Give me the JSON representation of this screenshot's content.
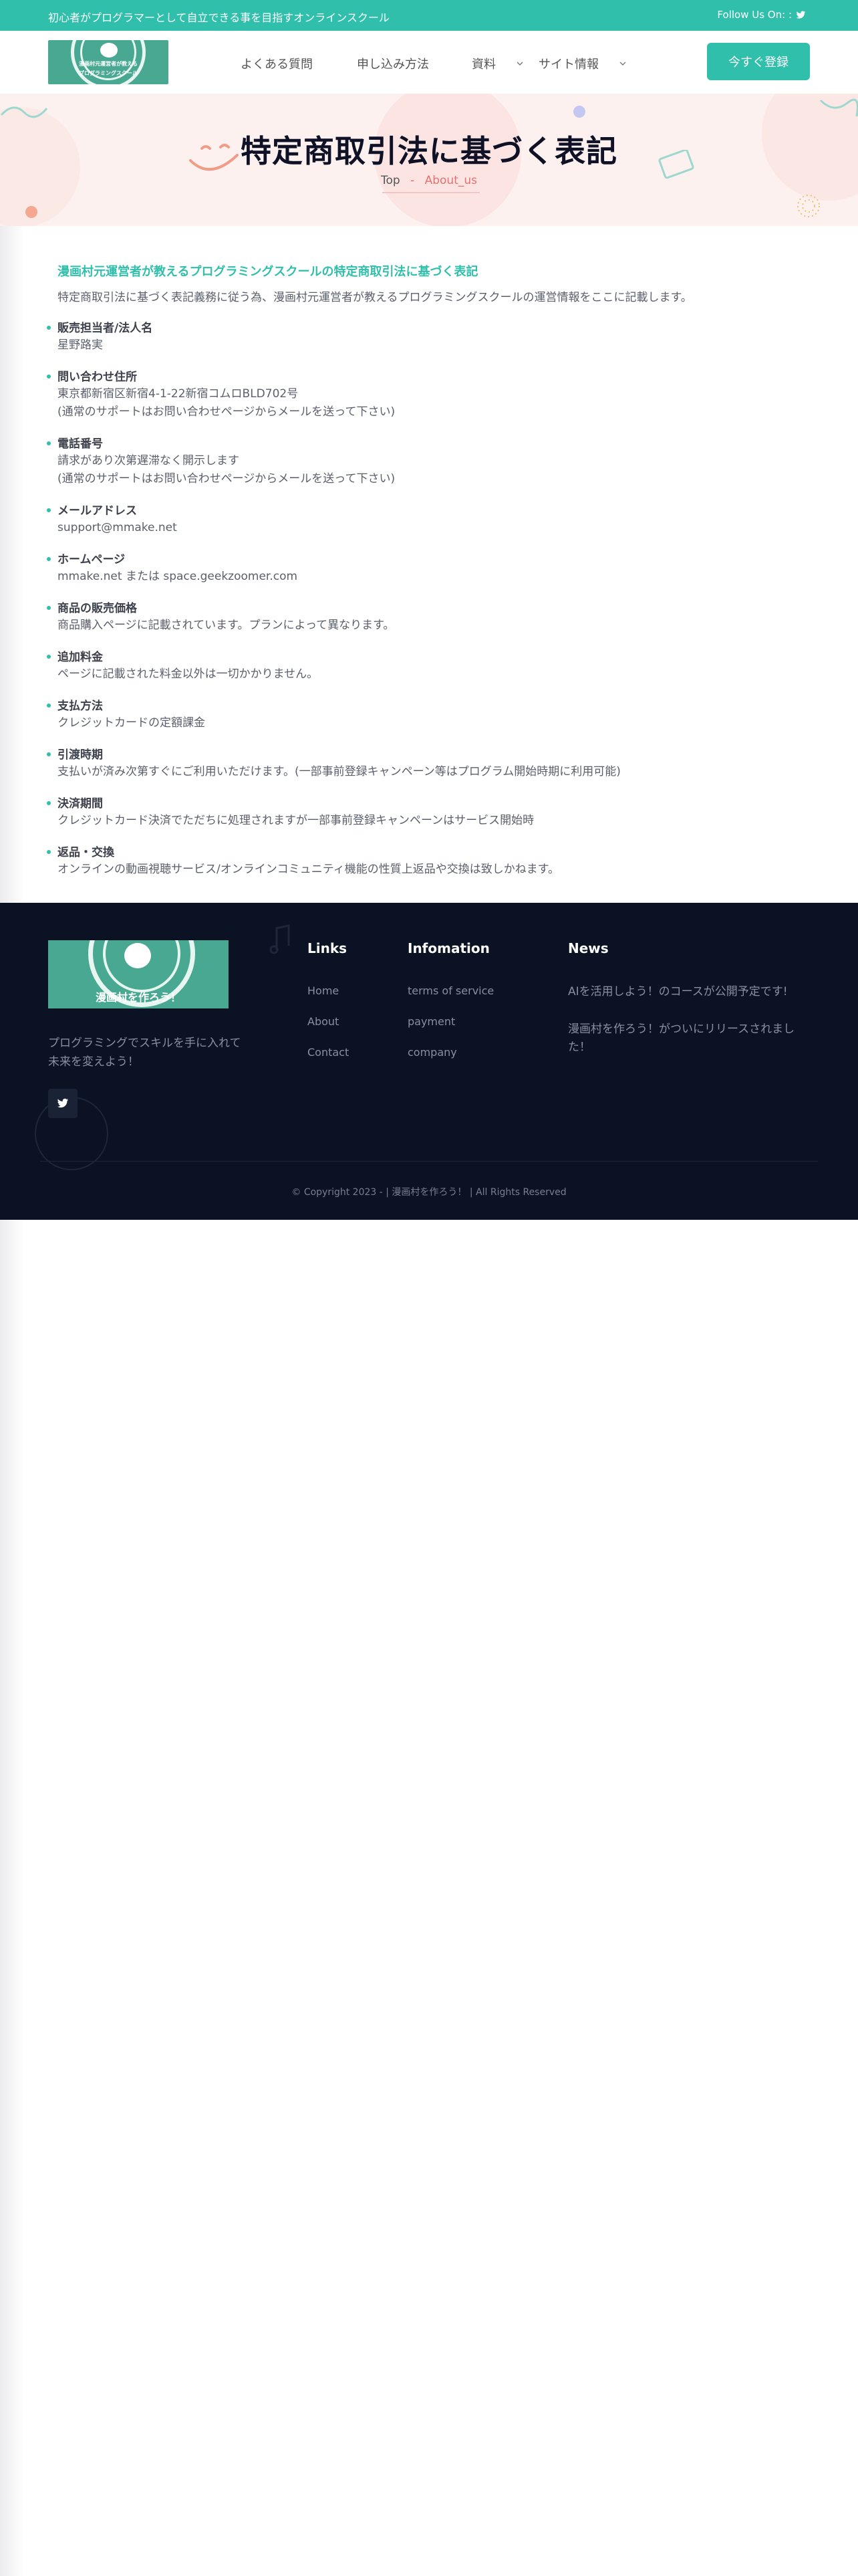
{
  "topbar": {
    "tagline": "初心者がプログラマーとして自立できる事を目指すオンラインスクール",
    "follow_label": "Follow Us On: :"
  },
  "header": {
    "logo_line1": "漫画村元運営者が教える",
    "logo_line2": "プログラミングスクール",
    "nav": [
      {
        "label": "よくある質問"
      },
      {
        "label": "申し込み方法"
      },
      {
        "label": "資料"
      },
      {
        "label": "サイト情報"
      }
    ],
    "cta_label": "今すぐ登録"
  },
  "hero": {
    "title": "特定商取引法に基づく表記",
    "breadcrumb_home": "Top",
    "breadcrumb_sep": "-",
    "breadcrumb_current": "About_us"
  },
  "content": {
    "intro_title": "漫画村元運営者が教えるプログラミングスクールの特定商取引法に基づく表記",
    "intro_text": "特定商取引法に基づく表記義務に従う為、漫画村元運営者が教えるプログラミングスクールの運営情報をここに記載します。",
    "items": [
      {
        "label": "販売担当者/法人名",
        "lines": [
          "星野路実"
        ]
      },
      {
        "label": "問い合わせ住所",
        "lines": [
          "東京都新宿区新宿4-1-22新宿コムロBLD702号",
          "(通常のサポートはお問い合わせページからメールを送って下さい)"
        ]
      },
      {
        "label": "電話番号",
        "lines": [
          "請求があり次第遅滞なく開示します",
          "(通常のサポートはお問い合わせページからメールを送って下さい)"
        ]
      },
      {
        "label": "メールアドレス",
        "lines": [
          "support@mmake.net"
        ]
      },
      {
        "label": "ホームページ",
        "lines": [
          "mmake.net または space.geekzoomer.com"
        ]
      },
      {
        "label": "商品の販売価格",
        "lines": [
          "商品購入ページに記載されています。プランによって異なります。"
        ]
      },
      {
        "label": "追加料金",
        "lines": [
          "ページに記載された料金以外は一切かかりません。"
        ]
      },
      {
        "label": "支払方法",
        "lines": [
          "クレジットカードの定額課金"
        ]
      },
      {
        "label": "引渡時期",
        "lines": [
          "支払いが済み次第すぐにご利用いただけます。(一部事前登録キャンペーン等はプログラム開始時期に利用可能)"
        ]
      },
      {
        "label": "決済期間",
        "lines": [
          "クレジットカード決済でただちに処理されますが一部事前登録キャンペーンはサービス開始時"
        ]
      },
      {
        "label": "返品・交換",
        "lines": [
          "オンラインの動画視聴サービス/オンラインコミュニティ機能の性質上返品や交換は致しかねます。"
        ]
      }
    ]
  },
  "footer": {
    "logo_text": "漫画村を作ろう！",
    "description": "プログラミングでスキルを手に入れて未来を変えよう！",
    "links_title": "Links",
    "links": [
      "Home",
      "About",
      "Contact"
    ],
    "info_title": "Infomation",
    "info_links": [
      "terms of service",
      "payment",
      "company"
    ],
    "news_title": "News",
    "news": [
      "AIを活用しよう！のコースが公開予定です!",
      "漫画村を作ろう！がついにリリースされました！"
    ],
    "copyright": "© Copyright 2023 - | 漫画村を作ろう！ | All Rights Reserved"
  },
  "colors": {
    "brand": "#2fbfab",
    "footer_bg": "#0b1224",
    "hero_bg": "#fdf1ef",
    "accent_red": "#e97070"
  },
  "icons": {
    "twitter": "twitter-icon",
    "chevron": "chevron-down-icon"
  }
}
